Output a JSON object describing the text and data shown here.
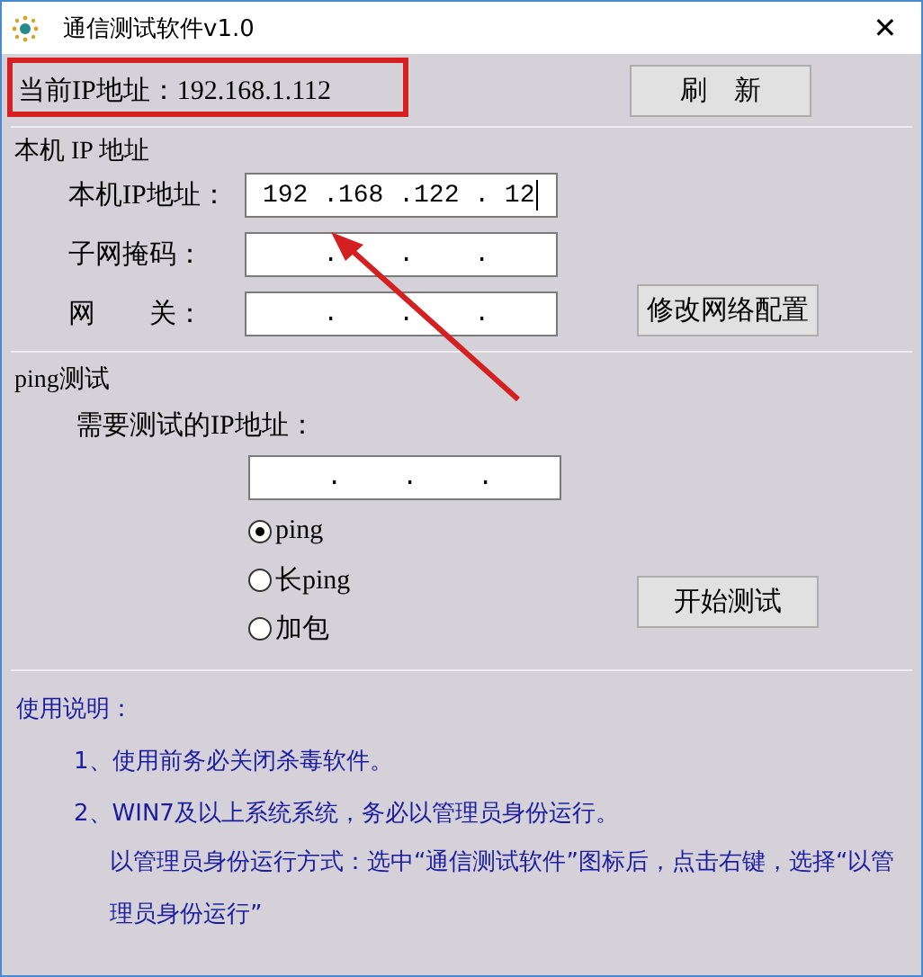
{
  "window": {
    "title": "通信测试软件v1.0",
    "close": "✕"
  },
  "current_ip": {
    "label": "当前IP地址：192.168.1.112",
    "refresh_button": "刷　新"
  },
  "local_group": {
    "title": "本机 IP 地址",
    "fields": [
      {
        "label": "本机IP地址：",
        "value": "192 .168 .122 . 12",
        "caret": true
      },
      {
        "label": "子网掩码：",
        "value": "    .    .    .",
        "caret": false
      },
      {
        "label": "网　　关：",
        "value": "    .    .    .",
        "caret": false
      }
    ],
    "modify_button": "修改网络配置"
  },
  "ping_group": {
    "title": "ping测试",
    "prompt": "需要测试的IP地址：",
    "field": {
      "value": "    .    .    ."
    },
    "modes": [
      {
        "label": "ping",
        "selected": true
      },
      {
        "label": "长ping",
        "selected": false
      },
      {
        "label": "加包",
        "selected": false
      }
    ],
    "start_button": "开始测试"
  },
  "instructions": {
    "title": "使用说明：",
    "lines": [
      {
        "text": "1、使用前务必关闭杀毒软件。",
        "indent": false
      },
      {
        "text": "2、WIN7及以上系统系统，务必以管理员身份运行。",
        "indent": false
      },
      {
        "text": "以管理员身份运行方式：选中“通信测试软件”图标后，点击右键，选择“以管理员身份运行”",
        "indent": true
      }
    ]
  }
}
